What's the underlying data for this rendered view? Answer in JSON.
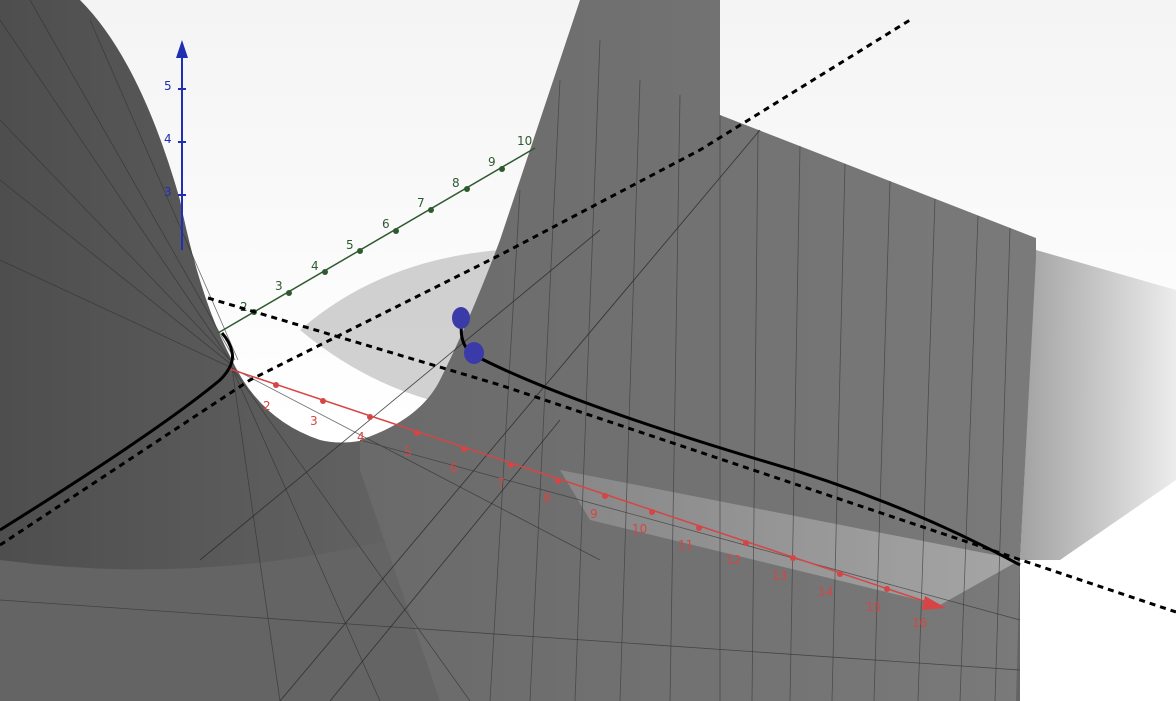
{
  "view": {
    "background_color": "#ffffff",
    "surface_color": "#5f5f5f",
    "curve_color": "#000000",
    "point_color": "#3a3aa8"
  },
  "axes": {
    "z": {
      "color": "#1f2fb3",
      "ticks": [
        "5",
        "4",
        "3"
      ]
    },
    "y": {
      "color": "#2f5a2f",
      "ticks": [
        "2",
        "3",
        "4",
        "5",
        "6",
        "7",
        "8",
        "9",
        "10"
      ]
    },
    "x": {
      "color": "#d64545",
      "ticks": [
        "2",
        "3",
        "4",
        "5",
        "6",
        "7",
        "8",
        "9",
        "10",
        "11",
        "12",
        "13",
        "14",
        "15",
        "16"
      ]
    }
  }
}
